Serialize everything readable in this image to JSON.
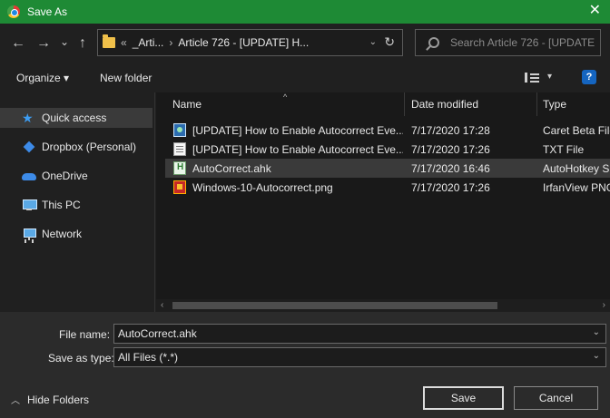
{
  "window": {
    "title": "Save As"
  },
  "nav": {
    "back": "←",
    "forward": "→",
    "recent": "⌄",
    "up": "↑",
    "refresh": "↻"
  },
  "address": {
    "overflow": "«",
    "crumbs": [
      "_Arti...",
      "Article 726 - [UPDATE] H..."
    ],
    "separator": "›"
  },
  "search": {
    "placeholder": "Search Article 726 - [UPDATE..."
  },
  "toolbar": {
    "organize": "Organize ▾",
    "new_folder": "New folder",
    "help": "?"
  },
  "sidebar": {
    "items": [
      {
        "label": "Quick access",
        "icon": "quick-access-star-icon",
        "selected": true
      },
      {
        "label": "Dropbox (Personal)",
        "icon": "dropbox-icon"
      },
      {
        "label": "OneDrive",
        "icon": "onedrive-cloud-icon"
      },
      {
        "label": "This PC",
        "icon": "computer-icon"
      },
      {
        "label": "Network",
        "icon": "network-icon"
      }
    ]
  },
  "columns": {
    "name": "Name",
    "date": "Date modified",
    "type": "Type",
    "sort_indicator": "^"
  },
  "files": [
    {
      "name": "[UPDATE] How to Enable Autocorrect Eve...",
      "date": "7/17/2020 17:28",
      "type": "Caret Beta File",
      "icon": "caret-file-icon"
    },
    {
      "name": "[UPDATE] How to Enable Autocorrect Eve...",
      "date": "7/17/2020 17:26",
      "type": "TXT File",
      "icon": "text-file-icon"
    },
    {
      "name": "AutoCorrect.ahk",
      "date": "7/17/2020 16:46",
      "type": "AutoHotkey S",
      "icon": "autohotkey-file-icon",
      "selected": true
    },
    {
      "name": "Windows-10-Autocorrect.png",
      "date": "7/17/2020 17:26",
      "type": "IrfanView PNG",
      "icon": "image-file-icon"
    }
  ],
  "form": {
    "filename_label": "File name:",
    "filename_value": "AutoCorrect.ahk",
    "savetype_label": "Save as type:",
    "savetype_value": "All Files (*.*)"
  },
  "footer": {
    "hide_folders": "Hide Folders",
    "save": "Save",
    "cancel": "Cancel"
  }
}
